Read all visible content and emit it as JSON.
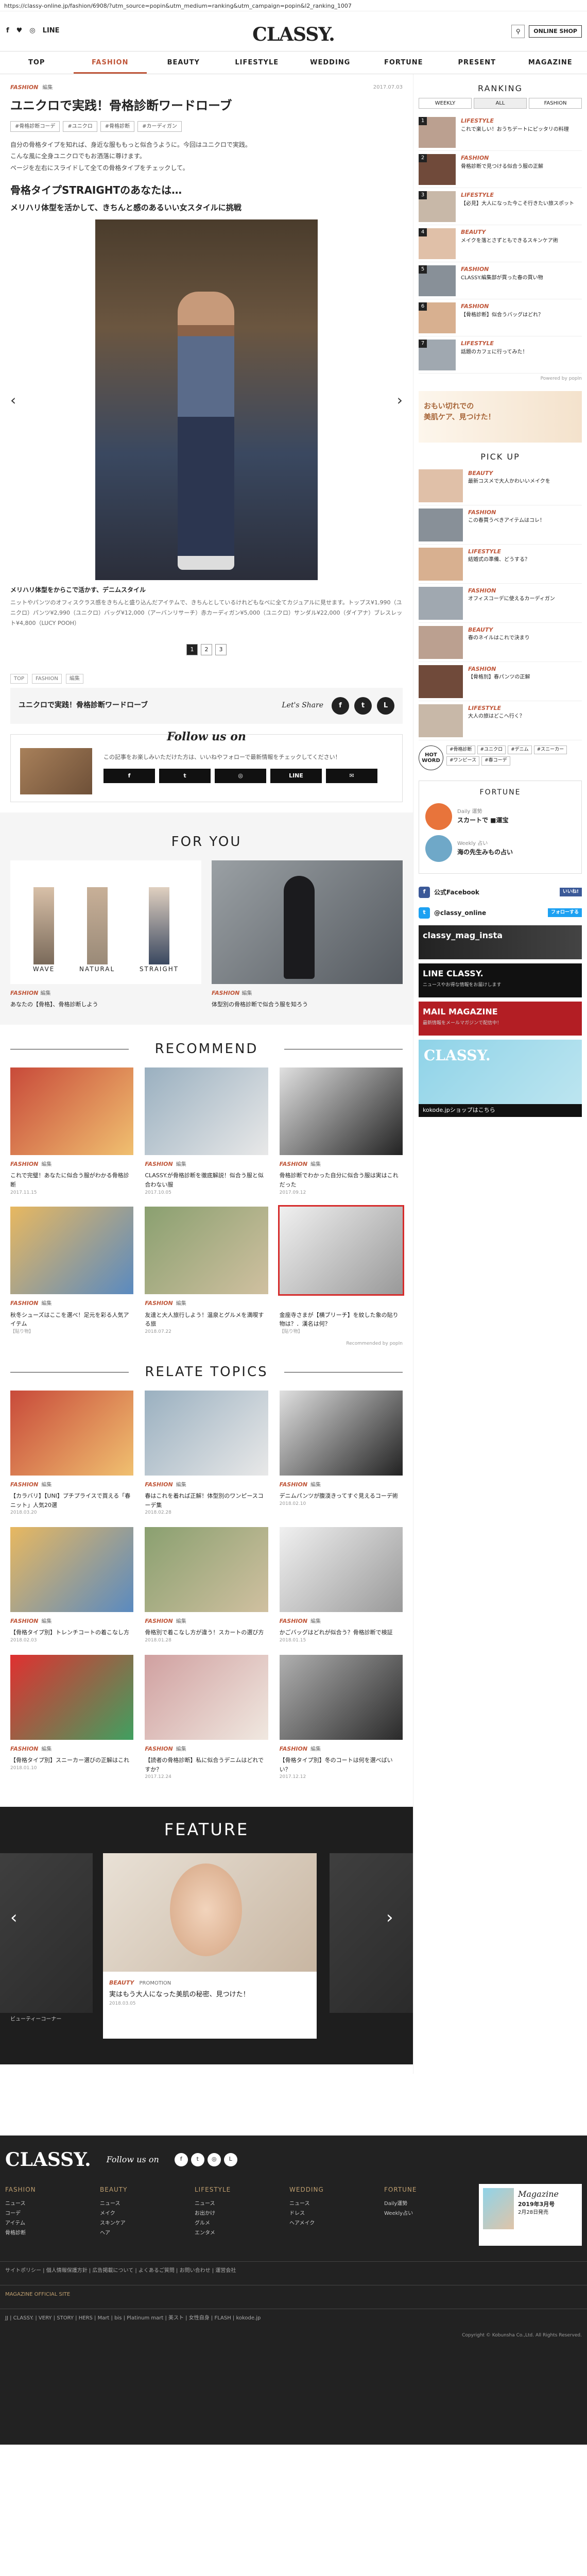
{
  "url": "https://classy-online.jp/fashion/6908/?utm_source=popin&utm_medium=ranking&utm_campaign=popin&l2_ranking_1007",
  "header": {
    "logo": "CLASSY.",
    "shop_label": "ONLINE SHOP",
    "social": [
      "f",
      "♥",
      "◎",
      "LINE"
    ]
  },
  "nav": [
    "TOP",
    "FASHION",
    "BEAUTY",
    "LIFESTYLE",
    "WEDDING",
    "FORTUNE",
    "PRESENT",
    "MAGAZINE"
  ],
  "nav_active": "FASHION",
  "article": {
    "category": "FASHION",
    "author": "編集",
    "date": "2017.07.03",
    "title": "ユニクロで実践！骨格診断ワードローブ",
    "tags": [
      "#骨格診断コーデ",
      "#ユニクロ",
      "#骨格診断",
      "#カーディガン"
    ],
    "lead": "自分の骨格タイプを知れば、身近な服ももっと似合うように。今回はユニクロで実践。\nこんな風に全身ユニクロでもお洒落に尊けます。\nページを左右にスライドして全ての骨格タイプをチェックして。",
    "h2": "骨格タイプSTRAIGHTのあなたは…",
    "h3": "メリハリ体型を活かして、きちんと感のあるいい女スタイルに挑戦",
    "caption_title": "メリハリ体型をからこで活かす、デニムスタイル",
    "caption": "ニットやパンツのオフィスクラス感をきちんと盛り込んだアイテムで、きちんとしているけれどもなべに全てカジュアルに見せます。トップス¥1,990（ユニクロ）パンツ¥2,990（ユニクロ）バッグ¥12,000（アーバンリサーチ）赤カーディガン¥5,000（ユニクロ）サンダル¥22,000（ダイアナ）ブレスレット¥4,800（LUCY POOH）",
    "pages": [
      "1",
      "2",
      "3"
    ]
  },
  "crumb": [
    "TOP",
    "FASHION",
    "編集"
  ],
  "share": {
    "title": "ユニクロで実践！骨格診断ワードローブ",
    "lets": "Let's Share",
    "buttons": [
      "f",
      "t",
      "L"
    ]
  },
  "follow": {
    "title": "Follow us on",
    "text": "この記事をお楽しみいただけた方は、いいねやフォローで最新情報をチェックしてください！",
    "buttons": [
      "f",
      "t",
      "◎",
      "LINE",
      "✉"
    ]
  },
  "foryou": {
    "title": "FOR YOU",
    "items": [
      {
        "category": "FASHION",
        "author": "編集",
        "title": "あなたの【骨格】、骨格診断しよう",
        "labels": [
          "WAVE",
          "NATURAL",
          "STRAIGHT"
        ]
      },
      {
        "category": "FASHION",
        "author": "編集",
        "title": "体型別の骨格診断で似合う服を知ろう",
        "labels": []
      }
    ]
  },
  "recommend": {
    "title": "RECOMMEND",
    "items": [
      {
        "category": "FASHION",
        "author": "編集",
        "title": "これで完璧！あなたに似合う服がわかる骨格診断",
        "date": "2017.11.15"
      },
      {
        "category": "FASHION",
        "author": "編集",
        "title": "CLASSY.が骨格診断を徹底解説！似合う服と似合わない服",
        "date": "2017.10.05"
      },
      {
        "category": "FASHION",
        "author": "編集",
        "title": "骨格診断でわかった自分に似合う服は実はこれだった",
        "date": "2017.09.12"
      },
      {
        "category": "FASHION",
        "author": "編集",
        "title": "秋冬シューズはここを選べ！足元を彩る人気アイテム",
        "date": "【貼り物】"
      },
      {
        "category": "FASHION",
        "author": "編集",
        "title": "友達と大人旅行しよう！温泉とグルメを満喫する旅",
        "date": "2018.07.22"
      },
      {
        "category": "",
        "author": "",
        "title": "金座寺さまが【横ブリーチ】を紋した象の貼り物は？．漢名は何？",
        "date": "【貼り物】",
        "highlight": true
      }
    ],
    "powered": "Recommended by popIn"
  },
  "topics": {
    "title": "RELATE TOPICS",
    "items": [
      {
        "category": "FASHION",
        "author": "編集",
        "title": "【カラバリ】【UNI】プチプライスで買える「春ニット」人気20選",
        "date": "2018.03.20"
      },
      {
        "category": "FASHION",
        "author": "編集",
        "title": "春はこれを着れば正解！体型別のワンピースコーデ集",
        "date": "2018.02.28"
      },
      {
        "category": "FASHION",
        "author": "編集",
        "title": "デニムパンツが腹渜きってすぐ見えるコーデ術",
        "date": "2018.02.10"
      },
      {
        "category": "FASHION",
        "author": "編集",
        "title": "【骨格タイプ別】トレンチコートの着こなし方",
        "date": "2018.02.03"
      },
      {
        "category": "FASHION",
        "author": "編集",
        "title": "骨格別で着こなし方が違う！スカートの選び方",
        "date": "2018.01.28"
      },
      {
        "category": "FASHION",
        "author": "編集",
        "title": "かごバッグはどれが似合う？骨格診断で検証",
        "date": "2018.01.15"
      },
      {
        "category": "FASHION",
        "author": "編集",
        "title": "【骨格タイプ別】スニーカー選びの正解はこれ",
        "date": "2018.01.10"
      },
      {
        "category": "FASHION",
        "author": "編集",
        "title": "【読者の骨格診断】私に似合うデニムはどれですか？",
        "date": "2017.12.24"
      },
      {
        "category": "FASHION",
        "author": "編集",
        "title": "【骨格タイプ別】冬のコートは何を選べばいい？",
        "date": "2017.12.12"
      }
    ]
  },
  "feature": {
    "title": "FEATURE",
    "category": "BEAUTY",
    "author": "PROMOTION",
    "item_title": "実はもう大人になった美肌の秘密、見つけた！",
    "date": "2018.03.05",
    "left_caption": "ビューティーコーナー"
  },
  "sidebar": {
    "ranking_title": "RANKING",
    "tabs": [
      "WEEKLY",
      "ALL",
      "FASHION"
    ],
    "ranking": [
      {
        "num": "1",
        "category": "LIFESTYLE",
        "title": "これで楽しい！おうちデートにピッタリの料理"
      },
      {
        "num": "2",
        "category": "FASHION",
        "title": "骨格診断で見つける似合う服の正解"
      },
      {
        "num": "3",
        "category": "LIFESTYLE",
        "title": "【必見】大人になった今こそ行きたい旅スポット"
      },
      {
        "num": "4",
        "category": "BEAUTY",
        "title": "メイクを落とさずともできるスキンケア術"
      },
      {
        "num": "5",
        "category": "FASHION",
        "title": "CLASSY.編集部が買った春の買い物"
      },
      {
        "num": "6",
        "category": "FASHION",
        "title": "【骨格診断】似合うバッグはどれ？"
      },
      {
        "num": "7",
        "category": "LIFESTYLE",
        "title": "話題のカフェに行ってみた！"
      }
    ],
    "ranking_more": "Powered by popIn",
    "banner1": "おもい切れでの\n美肌ケア、見つけた！",
    "pickup_title": "PICK UP",
    "pickup": [
      {
        "category": "BEAUTY",
        "title": "最新コスメで大人かわいいメイクを"
      },
      {
        "category": "FASHION",
        "title": "この春買うべきアイテムはコレ！"
      },
      {
        "category": "LIFESTYLE",
        "title": "結婚式の準備、どうする？"
      },
      {
        "category": "FASHION",
        "title": "オフィスコーデに使えるカーディガン"
      },
      {
        "category": "BEAUTY",
        "title": "春のネイルはこれで決まり"
      },
      {
        "category": "FASHION",
        "title": "【骨格別】春パンツの正解"
      },
      {
        "category": "LIFESTYLE",
        "title": "大人の旅はどこへ行く？"
      }
    ],
    "hot_label": "HOT\nWORD",
    "hot_tags": [
      "#骨格診断",
      "#ユニクロ",
      "#デニム",
      "#スニーカー",
      "#ワンピース",
      "#春コーデ"
    ],
    "fortune_title": "FORTUNE",
    "fortune": [
      {
        "name": "Daily 運勢",
        "text": "スカートで ■運宝"
      },
      {
        "name": "Weekly 占い",
        "text": "海の先生みもの占い"
      }
    ],
    "fb_label": "公式Facebook",
    "fb_btn": "いいね!",
    "tw_label": "@classy_online",
    "tw_btn": "フォローする",
    "insta": "classy_mag_insta",
    "line": "LINE CLASSY.",
    "line_sub": "ニュースやお得な情報をお届けします",
    "mail": "MAIL MAGAZINE",
    "mail_sub": "最新情報をメールマガジンで配信中！",
    "mag_title": "CLASSY.",
    "mag_sub": "kokode.jpショップはこちら"
  },
  "footer": {
    "logo": "CLASSY.",
    "follow": "Follow us on",
    "cols": [
      {
        "h": "FASHION",
        "items": [
          "ニュース",
          "コーデ",
          "アイテム",
          "骨格診断"
        ]
      },
      {
        "h": "BEAUTY",
        "items": [
          "ニュース",
          "メイク",
          "スキンケア",
          "ヘア"
        ]
      },
      {
        "h": "LIFESTYLE",
        "items": [
          "ニュース",
          "お出かけ",
          "グルメ",
          "エンタメ"
        ]
      },
      {
        "h": "WEDDING",
        "items": [
          "ニュース",
          "ドレス",
          "ヘアメイク"
        ]
      },
      {
        "h": "FORTUNE",
        "items": [
          "Daily運勢",
          "Weekly占い"
        ]
      }
    ],
    "mag": {
      "title": "Magazine",
      "issue": "2019年3月号",
      "sub": "2月28日発売"
    },
    "links": "サイトポリシー | 個人情報保護方針 | 広告掲載について | よくあるご質問 | お問い合わせ | 運営会社",
    "sites_title": "MAGAZINE OFFICIAL SITE",
    "sites": "JJ | CLASSY. | VERY | STORY | HERS | Mart | bis | Platinum mart | 美スト | 女性自身 | FLASH | kokode.jp",
    "copy": "Copyright © Kobunsha Co.,Ltd. All Rights Reserved."
  }
}
